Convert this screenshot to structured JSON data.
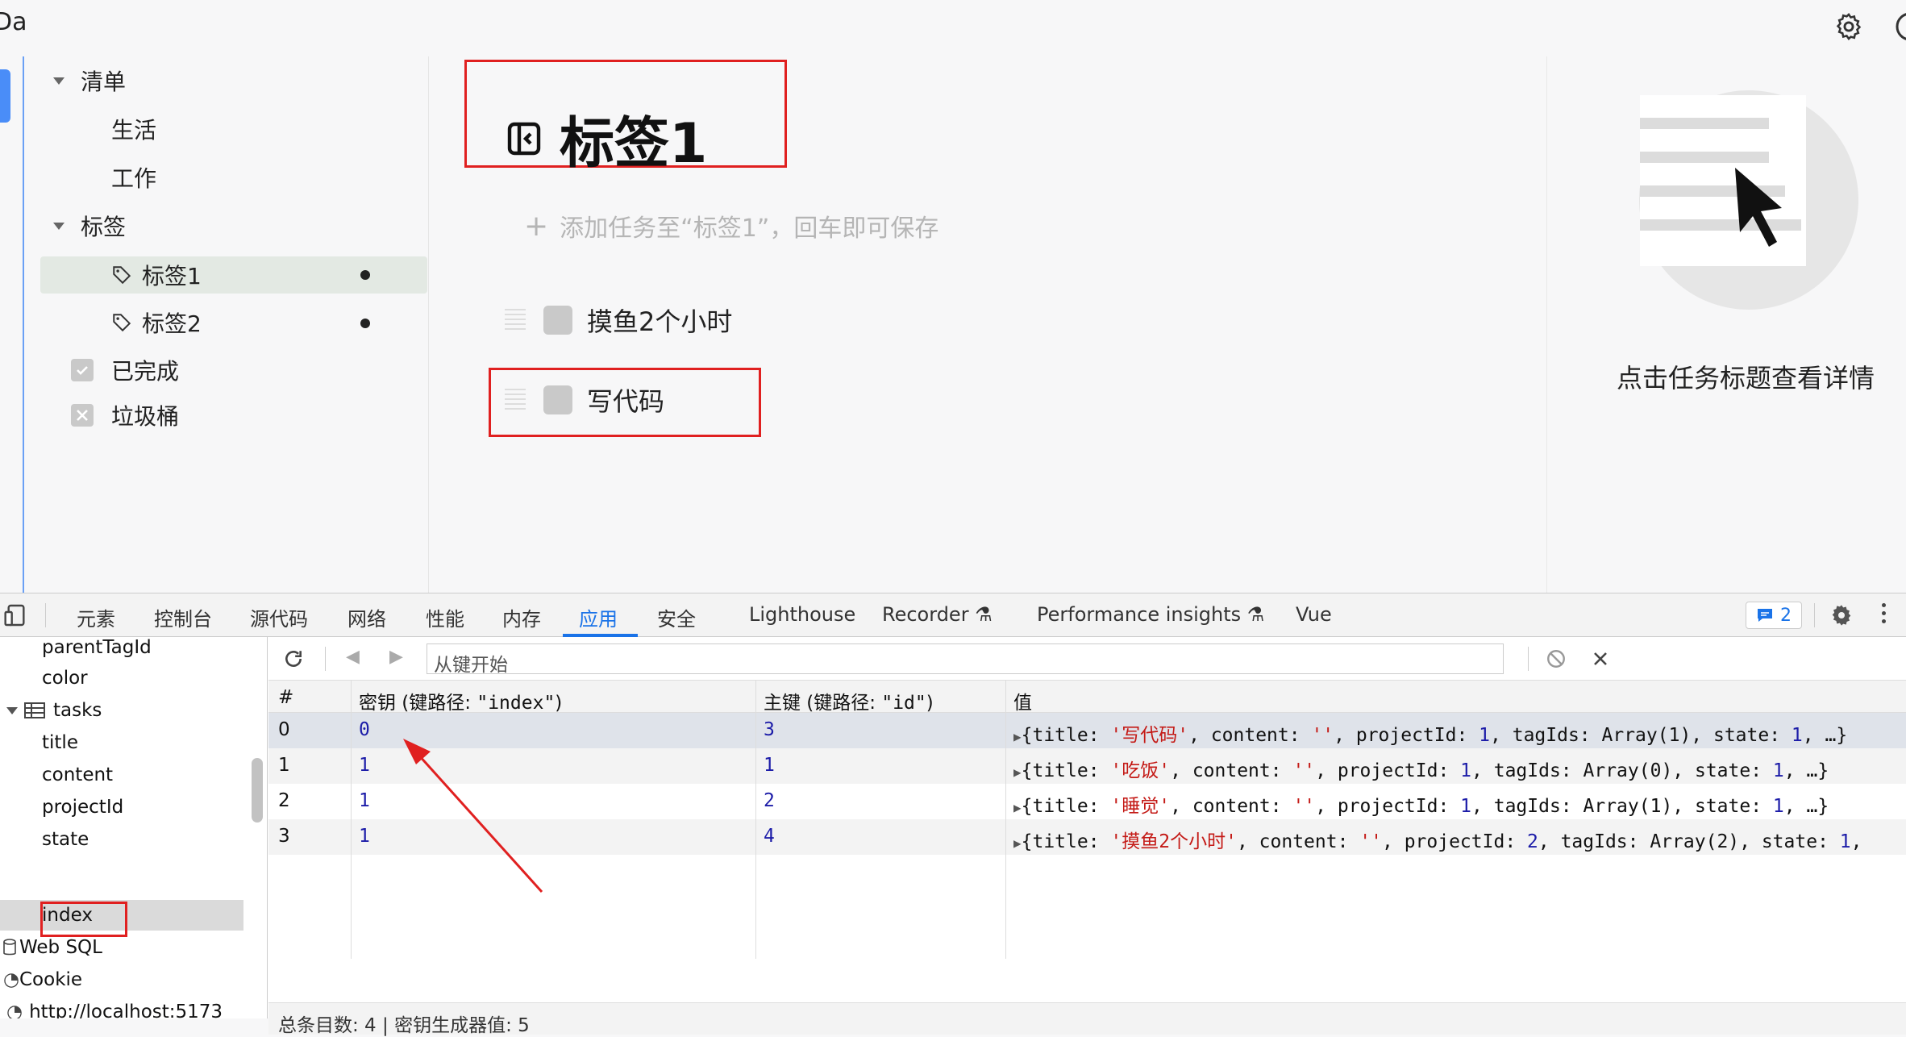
{
  "app": {
    "title": "Da"
  },
  "sidebar": {
    "lists_label": "清单",
    "list_items": [
      "生活",
      "工作"
    ],
    "tags_label": "标签",
    "tag_items": [
      "标签1",
      "标签2"
    ],
    "done_label": "已完成",
    "trash_label": "垃圾桶"
  },
  "content": {
    "title": "标签1",
    "add_placeholder": "添加任务至“标签1”，回车即可保存",
    "tasks": [
      "摸鱼2个小时",
      "写代码"
    ]
  },
  "detail": {
    "hint": "点击任务标题查看详情"
  },
  "devtools": {
    "tabs": [
      "元素",
      "控制台",
      "源代码",
      "网络",
      "性能",
      "内存",
      "应用",
      "安全",
      "Lighthouse",
      "Recorder",
      "Performance insights",
      "Vue"
    ],
    "active_tab": "应用",
    "issues_count": "2",
    "tree": {
      "items": [
        "parentTagId",
        "color",
        "tasks",
        "title",
        "content",
        "projectId",
        "state",
        "index",
        "Web SQL",
        "Cookie",
        "http://localhost:5173"
      ]
    },
    "filter_placeholder": "从键开始",
    "table": {
      "headers": {
        "num": "#",
        "key": "密钥 (键路径: ",
        "key_path": "\"index\"",
        "key_close": ")",
        "primary": "主键 (键路径: ",
        "primary_path": "\"id\"",
        "primary_close": ")",
        "value": "值"
      },
      "rows": [
        {
          "num": "0",
          "key": "0",
          "primary": "3",
          "title": "'写代码'",
          "project": "1",
          "tags": "Array(1)",
          "state": "1",
          "tail": ", …}"
        },
        {
          "num": "1",
          "key": "1",
          "primary": "1",
          "title": "'吃饭'",
          "project": "1",
          "tags": "Array(0)",
          "state": "1",
          "tail": ", …}"
        },
        {
          "num": "2",
          "key": "1",
          "primary": "2",
          "title": "'睡觉'",
          "project": "1",
          "tags": "Array(1)",
          "state": "1",
          "tail": ", …}"
        },
        {
          "num": "3",
          "key": "1",
          "primary": "4",
          "title": "'摸鱼2个小时'",
          "project": "2",
          "tags": "Array(2)",
          "state": "1",
          "tail": ","
        }
      ]
    },
    "footer": "总条目数: 4 | 密钥生成器值: 5"
  }
}
